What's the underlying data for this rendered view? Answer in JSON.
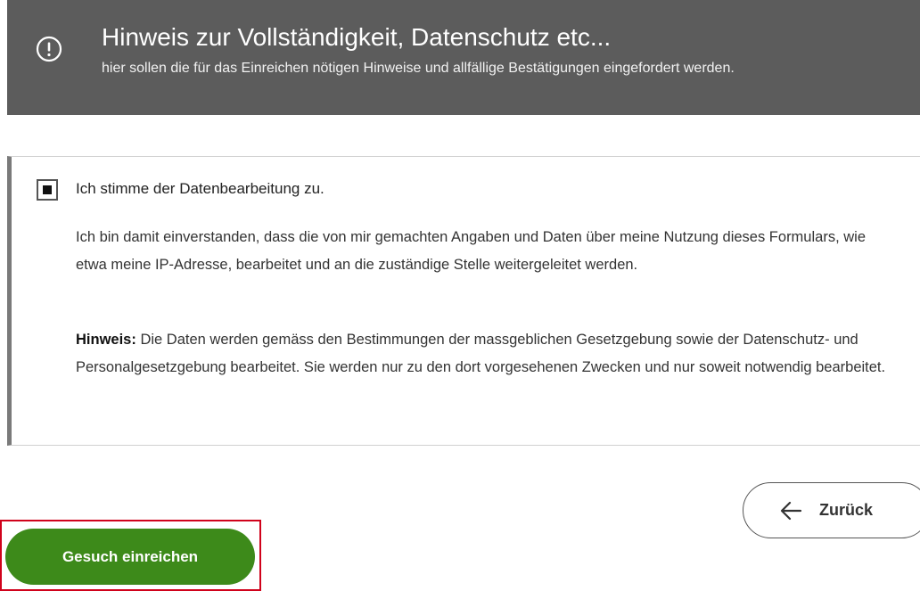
{
  "banner": {
    "icon": "exclamation-circle-icon",
    "title": "Hinweis zur Vollständigkeit, Datenschutz etc...",
    "subtitle": "hier sollen die für das Einreichen nötigen Hinweise und allfällige Bestätigungen eingefordert werden."
  },
  "consent": {
    "checked": true,
    "label": "Ich stimme der Datenbearbeitung zu.",
    "paragraph": "Ich bin damit einverstanden, dass die von mir gemachten Angaben und Daten über meine Nutzung dieses Formulars, wie etwa meine IP-Adresse, bearbeitet und an die zuständige Stelle weitergeleitet werden.",
    "note_label": "Hinweis:",
    "note_text": " Die Daten werden gemäss den Bestimmungen der massgeblichen Gesetzgebung sowie der Datenschutz- und Personalgesetzgebung bearbeitet. Sie werden nur zu den dort vorgesehenen Zwecken und nur soweit notwendig bearbeitet."
  },
  "actions": {
    "back_label": "Zurück",
    "back_icon": "arrow-left-icon",
    "submit_label": "Gesuch einreichen"
  },
  "colors": {
    "banner_bg": "#5c5c5c",
    "submit_bg": "#3d8a1a",
    "highlight_border": "#d0021b"
  }
}
